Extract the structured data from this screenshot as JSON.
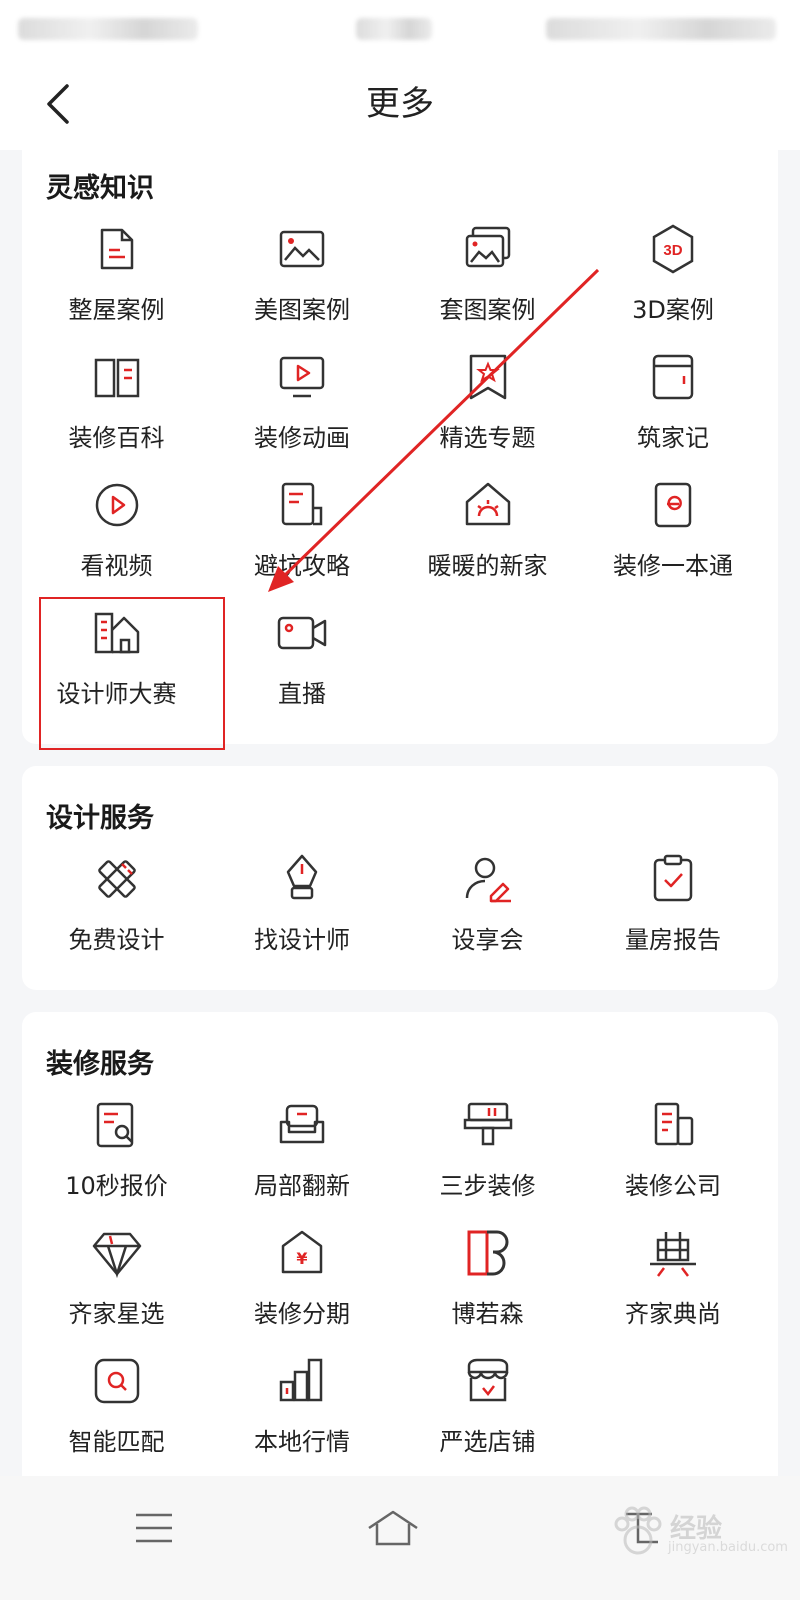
{
  "header": {
    "title": "更多"
  },
  "sections": [
    {
      "title": "灵感知识",
      "items": [
        {
          "label": "整屋案例",
          "icon": "document-icon"
        },
        {
          "label": "美图案例",
          "icon": "image-icon"
        },
        {
          "label": "套图案例",
          "icon": "image-stack-icon"
        },
        {
          "label": "3D案例",
          "icon": "3d-hexagon-icon"
        },
        {
          "label": "装修百科",
          "icon": "book-icon"
        },
        {
          "label": "装修动画",
          "icon": "tv-play-icon"
        },
        {
          "label": "精选专题",
          "icon": "bookmark-star-icon"
        },
        {
          "label": "筑家记",
          "icon": "notebook-icon"
        },
        {
          "label": "看视频",
          "icon": "play-circle-icon"
        },
        {
          "label": "避坑攻略",
          "icon": "guide-note-icon"
        },
        {
          "label": "暖暖的新家",
          "icon": "house-sun-icon"
        },
        {
          "label": "装修一本通",
          "icon": "handbook-icon"
        },
        {
          "label": "设计师大赛",
          "icon": "building-icon"
        },
        {
          "label": "直播",
          "icon": "video-camera-icon"
        }
      ]
    },
    {
      "title": "设计服务",
      "items": [
        {
          "label": "免费设计",
          "icon": "ruler-pencil-icon"
        },
        {
          "label": "找设计师",
          "icon": "pen-nib-icon"
        },
        {
          "label": "设享会",
          "icon": "user-edit-icon"
        },
        {
          "label": "量房报告",
          "icon": "clipboard-check-icon"
        }
      ]
    },
    {
      "title": "装修服务",
      "items": [
        {
          "label": "10秒报价",
          "icon": "quote-search-icon"
        },
        {
          "label": "局部翻新",
          "icon": "sofa-icon"
        },
        {
          "label": "三步装修",
          "icon": "paint-roller-icon"
        },
        {
          "label": "装修公司",
          "icon": "office-building-icon"
        },
        {
          "label": "齐家星选",
          "icon": "diamond-icon"
        },
        {
          "label": "装修分期",
          "icon": "house-yen-icon"
        },
        {
          "label": "博若森",
          "icon": "brand-db-icon"
        },
        {
          "label": "齐家典尚",
          "icon": "dian-character-icon"
        },
        {
          "label": "智能匹配",
          "icon": "smart-match-icon"
        },
        {
          "label": "本地行情",
          "icon": "bar-chart-icon"
        },
        {
          "label": "严选店铺",
          "icon": "store-icon"
        }
      ]
    }
  ],
  "watermark": {
    "text": "经验",
    "sub": "jingyan.baidu.com"
  },
  "colors": {
    "accent": "#e02424",
    "icon_stroke": "#333333",
    "card_bg": "#ffffff",
    "page_bg": "#f5f6f8"
  }
}
